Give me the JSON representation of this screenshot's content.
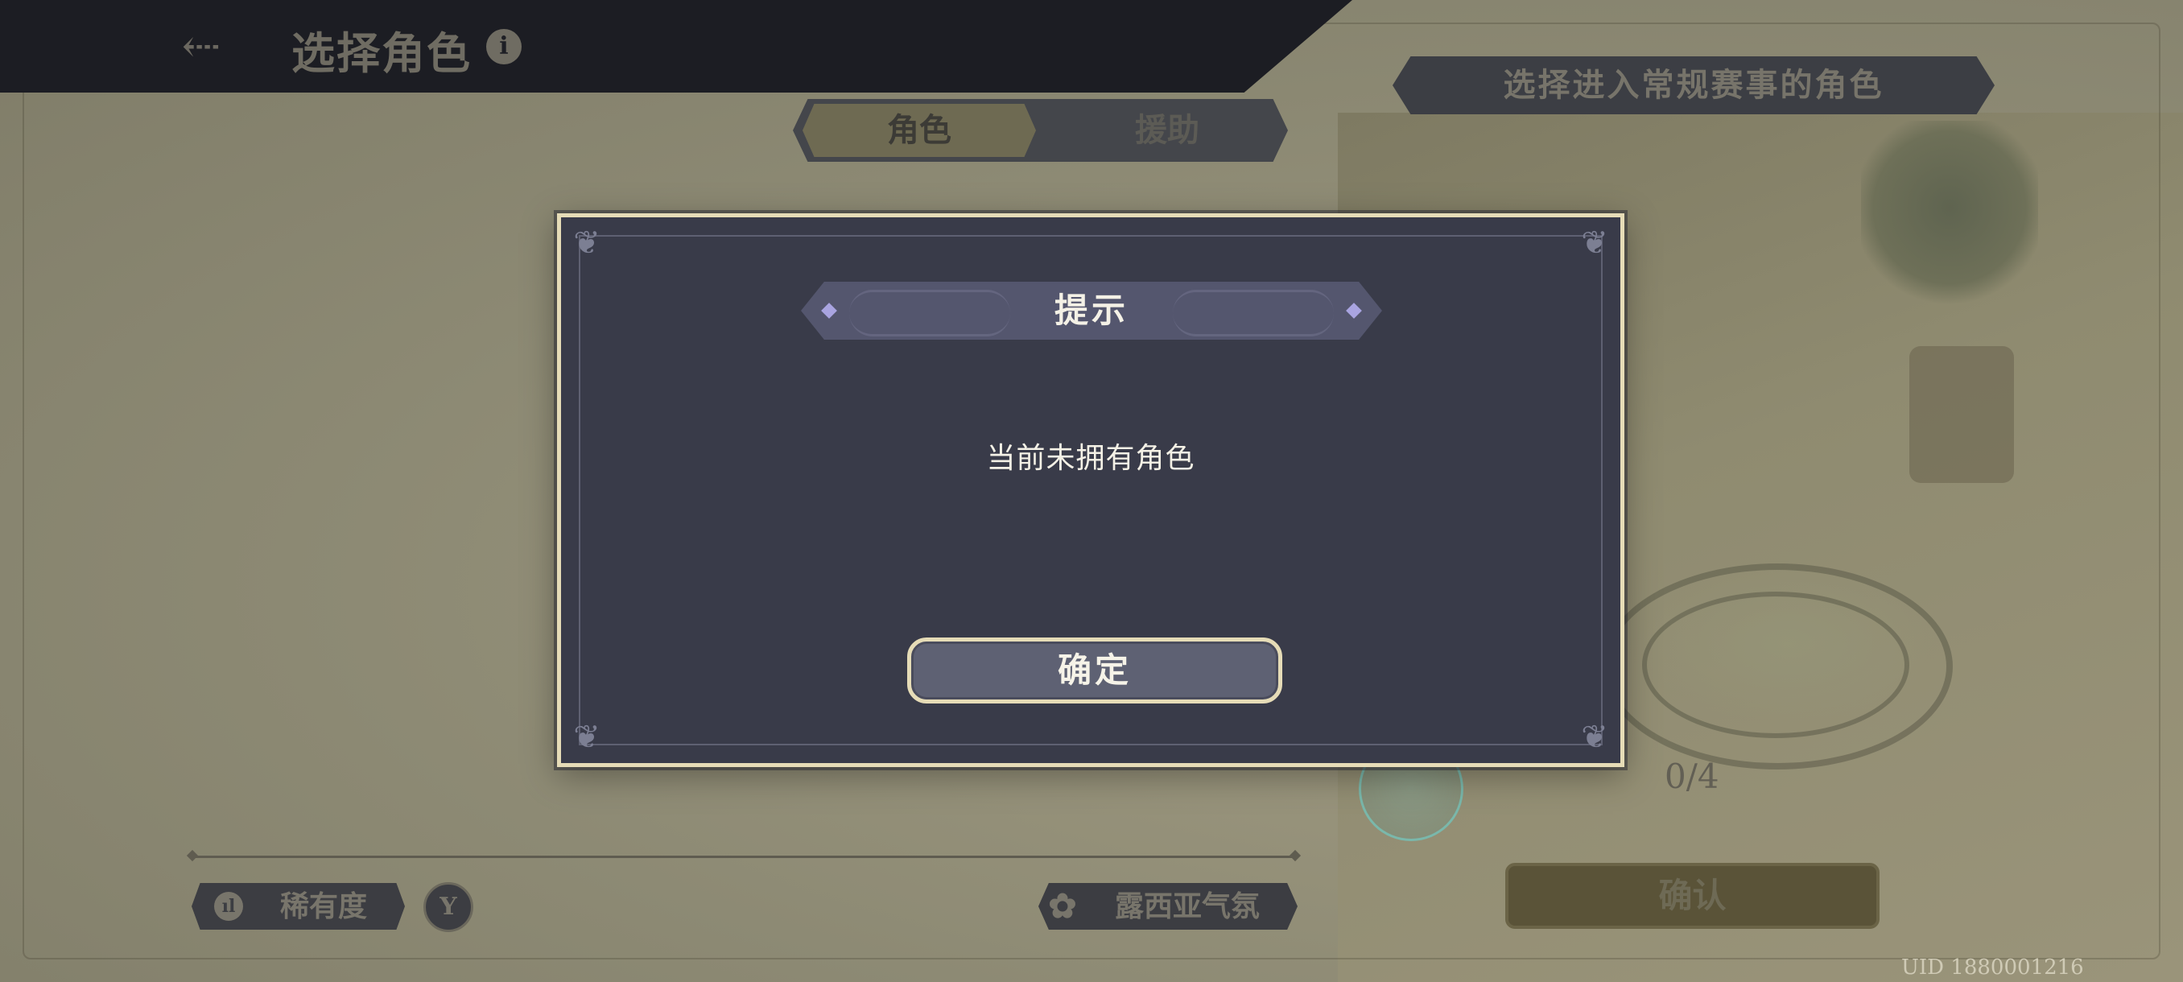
{
  "header": {
    "back_icon": "back-arrow-icon",
    "title": "选择角色",
    "info_icon": "info-icon",
    "info_glyph": "i"
  },
  "mode_banner": "选择进入常规赛事的角色",
  "tabs": [
    {
      "label": "角色",
      "active": true
    },
    {
      "label": "援助",
      "active": false
    }
  ],
  "bottom_bar": {
    "rarity_label": "稀有度",
    "rarity_icon": "bar-chart-icon",
    "filter_icon": "filter-icon",
    "atmosphere_label": "露西亚气氛",
    "atmosphere_icon": "flower-icon"
  },
  "team": {
    "count": "0/4",
    "confirm_label": "确认"
  },
  "uid": "UID 1880001216",
  "dialog": {
    "title": "提示",
    "message": "当前未拥有角色",
    "confirm_label": "确定"
  },
  "colors": {
    "dialog_bg": "#393b49",
    "dialog_border": "#e6dcb7",
    "title_bar": "#54566e",
    "accent_diamond": "#a9a4e0"
  }
}
